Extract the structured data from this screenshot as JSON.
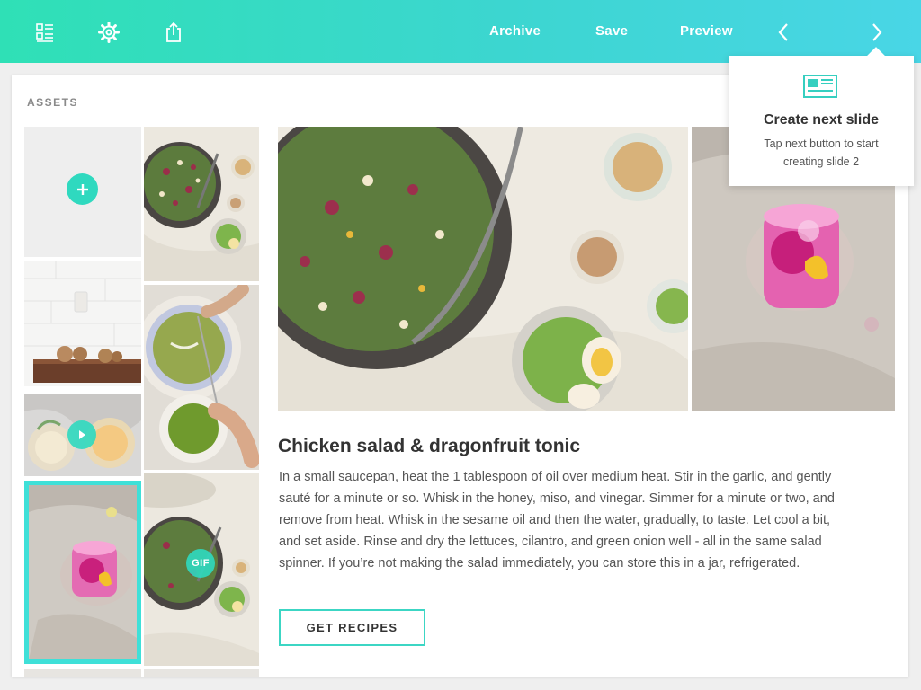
{
  "toolbar": {
    "icons": [
      "layout-icon",
      "gear-icon",
      "share-icon"
    ],
    "archive_label": "Archive",
    "save_label": "Save",
    "preview_label": "Preview",
    "prev_icon": "chevron-left-icon",
    "next_icon": "chevron-right-icon",
    "accent_from": "#2fe0b6",
    "accent_to": "#49d6e6"
  },
  "assets": {
    "title": "ASSETS",
    "add_icon": "plus-icon",
    "video_badge_icon": "play-icon",
    "gif_badge": "GIF",
    "items": [
      "salad-bowl-photo",
      "chopping-board-photo",
      "green-soup-photo",
      "cocktails-video",
      "pink-tonic-photo-selected",
      "salad-bowl-gif"
    ]
  },
  "slide": {
    "title": "Chicken salad & dragonfruit tonic",
    "body": "In a small saucepan, heat the 1 tablespoon of oil over medium heat. Stir in the garlic, and gently sauté for a minute or so. Whisk in the honey, miso, and vinegar. Simmer for a minute or two, and remove from heat. Whisk in the sesame oil and then the water, gradually, to taste. Let cool a bit, and set aside. Rinse and dry the lettuces, cilantro, and green onion well - all in the same salad spinner. If you’re not making the salad immediately, you can store this in a jar, refrigerated.",
    "cta_label": "GET RECIPES",
    "accent": "#3cd6c4"
  },
  "tooltip": {
    "icon": "slide-layout-icon",
    "title": "Create next slide",
    "text": "Tap next button to start creating slide 2"
  }
}
